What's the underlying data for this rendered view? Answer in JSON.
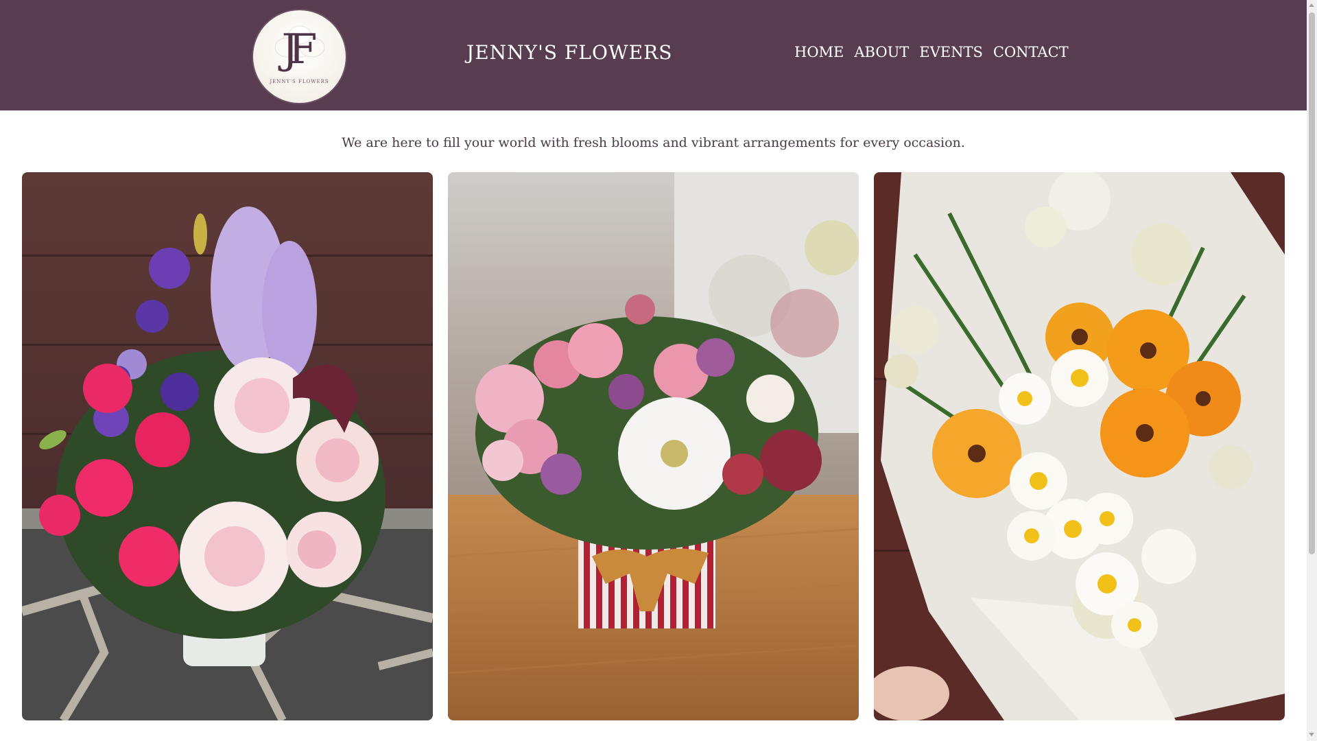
{
  "colors": {
    "header_bg": "#573d4f",
    "nav_text": "#ffffff",
    "body_text": "#4a3a44"
  },
  "header": {
    "logo": {
      "monogram": "JF",
      "subtitle": "JENNY'S FLOWERS"
    },
    "title": "JENNY'S FLOWERS",
    "nav": [
      {
        "label": "HOME"
      },
      {
        "label": "ABOUT"
      },
      {
        "label": "EVENTS"
      },
      {
        "label": "CONTACT"
      }
    ]
  },
  "main": {
    "tagline": "We are here to fill your world with fresh blooms and vibrant arrangements for every occasion."
  }
}
